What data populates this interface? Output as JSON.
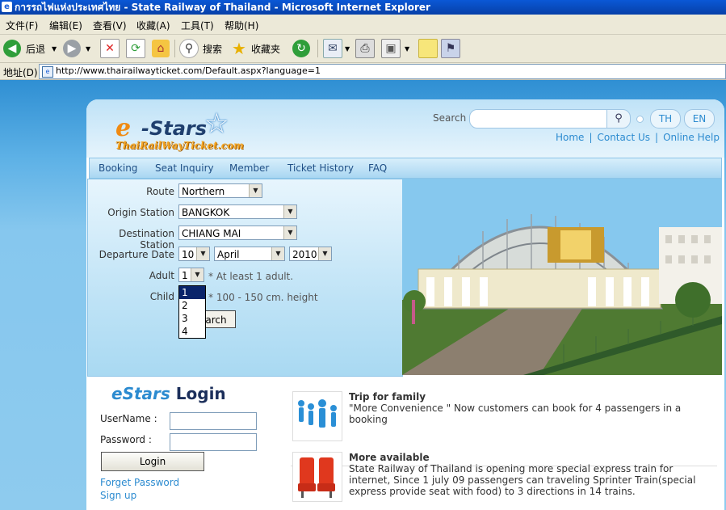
{
  "window": {
    "title": "การรถไฟแห่งประเทศไทย - State Railway of Thailand - Microsoft Internet Explorer"
  },
  "menu": [
    "文件(F)",
    "编辑(E)",
    "查看(V)",
    "收藏(A)",
    "工具(T)",
    "帮助(H)"
  ],
  "toolbar": {
    "back": "后退",
    "search": "搜索",
    "favorites": "收藏夹"
  },
  "address": {
    "label": "地址(D)",
    "url": "http://www.thairailwayticket.com/Default.aspx?language=1"
  },
  "site": {
    "logo_e": "e",
    "logo_stars": "-Stars",
    "logo_sub": "ThaiRailWayTicket.com",
    "search_label": "Search",
    "lang_th": "TH",
    "lang_en": "EN",
    "links": {
      "home": "Home",
      "contact": "Contact Us",
      "help": "Online Help",
      "sep": "|"
    },
    "nav": [
      "Booking",
      "Seat Inquiry",
      "Member",
      "Ticket History",
      "FAQ"
    ]
  },
  "form": {
    "route_label": "Route",
    "route_value": "Northern",
    "origin_label": "Origin Station",
    "origin_value": "BANGKOK",
    "dest_label": "Destination Station",
    "dest_value": "CHIANG MAI",
    "date_label": "Departure Date",
    "day": "10",
    "month": "April",
    "year": "2010",
    "adult_label": "Adult",
    "adult_value": "1",
    "adult_hint": "* At least 1 adult.",
    "child_label": "Child",
    "child_hint": "* 100 - 150 cm. height",
    "search_button": "earch",
    "adult_options": [
      "1",
      "2",
      "3",
      "4"
    ]
  },
  "login": {
    "title_a": "eStars",
    "title_b": "Login",
    "username_label": "UserName :",
    "password_label": "Password :",
    "button": "Login",
    "forget": "Forget Password",
    "signup": "Sign up"
  },
  "news": [
    {
      "title": "Trip for family",
      "desc": "\"More Convenience \" Now customers can book for 4 passengers in a booking"
    },
    {
      "title": "More available",
      "desc": "State Railway of Thailand is opening more special express train for internet, Since 1 july 09 passengers can traveling Sprinter Train(special express provide seat with food) to 3 directions in 14 trains."
    }
  ],
  "colors": {
    "accent": "#2c8bd0",
    "brand_orange": "#f08a12",
    "ie_blue": "#0a58d6"
  }
}
